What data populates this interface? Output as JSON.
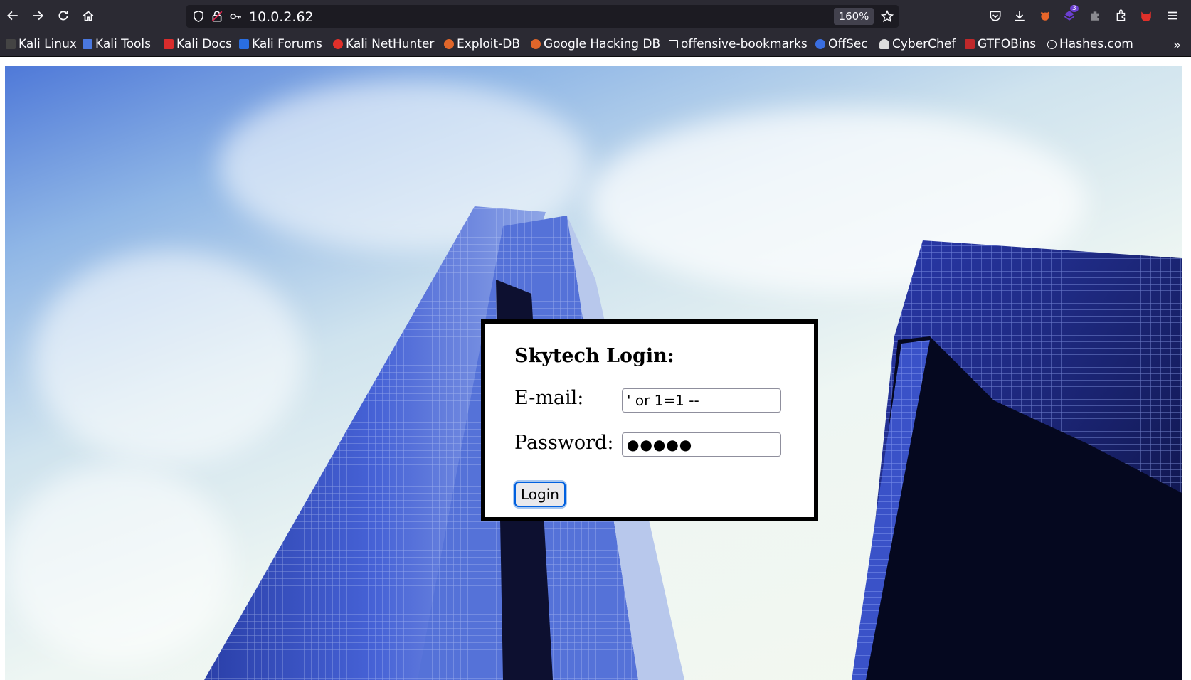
{
  "browser": {
    "url": "10.0.2.62",
    "zoom": "160%",
    "extension_badge": "3"
  },
  "bookmarks": [
    {
      "label": "Kali Linux",
      "icon": "kali-dragon-icon",
      "color": "#3a3a3a"
    },
    {
      "label": "Kali Tools",
      "icon": "kali-tools-icon",
      "color": "#4a78e0"
    },
    {
      "label": "Kali Docs",
      "icon": "kali-docs-icon",
      "color": "#d92c2c"
    },
    {
      "label": "Kali Forums",
      "icon": "kali-forums-icon",
      "color": "#2a6ee0"
    },
    {
      "label": "Kali NetHunter",
      "icon": "kali-nethunter-icon",
      "color": "#e0302a"
    },
    {
      "label": "Exploit-DB",
      "icon": "exploit-db-icon",
      "color": "#e0662a"
    },
    {
      "label": "Google Hacking DB",
      "icon": "ghdb-icon",
      "color": "#e0662a"
    },
    {
      "label": "offensive-bookmarks",
      "icon": "folder-icon",
      "color": "#fbfbfe"
    },
    {
      "label": "OffSec",
      "icon": "offsec-icon",
      "color": "#3a6ee0"
    },
    {
      "label": "CyberChef",
      "icon": "cyberchef-icon",
      "color": "#dddddd"
    },
    {
      "label": "GTFOBins",
      "icon": "gtfobins-icon",
      "color": "#c0282a"
    },
    {
      "label": "Hashes.com",
      "icon": "hashes-icon",
      "color": "#fbfbfe"
    }
  ],
  "login": {
    "title": "Skytech Login:",
    "email_label": "E-mail:",
    "email_value": "' or 1=1 --",
    "password_label": "Password:",
    "password_value": "●●●●●",
    "button_label": "Login"
  }
}
